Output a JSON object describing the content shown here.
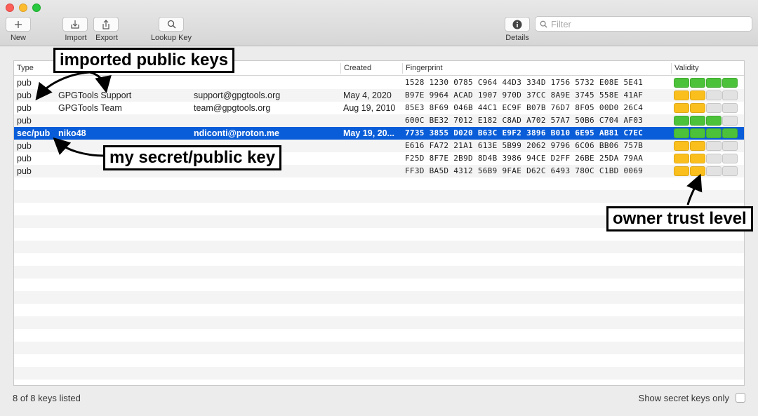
{
  "toolbar": {
    "new_label": "New",
    "import_label": "Import",
    "export_label": "Export",
    "lookup_label": "Lookup Key",
    "details_label": "Details",
    "filter_placeholder": "Filter"
  },
  "table": {
    "columns": {
      "type": "Type",
      "created": "Created",
      "fingerprint": "Fingerprint",
      "validity": "Validity"
    },
    "rows": [
      {
        "type": "pub",
        "name": "",
        "email": "",
        "created": "",
        "fingerprint": "1528 1230 0785 C964 44D3  334D 1756 5732 E08E 5E41",
        "validity": [
          "green",
          "green",
          "green",
          "green"
        ],
        "selected": false
      },
      {
        "type": "pub",
        "name": "GPGTools Support",
        "email": "support@gpgtools.org",
        "created": "May 4, 2020",
        "fingerprint": "B97E 9964 ACAD 1907 970D  37CC 8A9E 3745 558E 41AF",
        "validity": [
          "yellow",
          "yellow",
          "gray",
          "gray"
        ],
        "selected": false
      },
      {
        "type": "pub",
        "name": "GPGTools Team",
        "email": "team@gpgtools.org",
        "created": "Aug 19, 2010",
        "fingerprint": "85E3 8F69 046B 44C1 EC9F  B07B 76D7 8F05 00D0 26C4",
        "validity": [
          "yellow",
          "yellow",
          "gray",
          "gray"
        ],
        "selected": false
      },
      {
        "type": "pub",
        "name": "",
        "email": "",
        "created": "",
        "fingerprint": "600C BE32 7012 E182 C8AD  A702 57A7 50B6 C704 AF03",
        "validity": [
          "green",
          "green",
          "green",
          "gray"
        ],
        "selected": false
      },
      {
        "type": "sec/pub",
        "name": "niko48",
        "email": "ndiconti@proton.me",
        "created": "May 19, 20...",
        "fingerprint": "7735 3855 D020 B63C E9F2  3896 B010 6E95 AB81 C7EC",
        "validity": [
          "green",
          "green",
          "green",
          "green"
        ],
        "selected": true
      },
      {
        "type": "pub",
        "name": "",
        "email": "",
        "created": "",
        "fingerprint": "E616 FA72 21A1 613E 5B99  2062 9796 6C06 BB06 757B",
        "validity": [
          "yellow",
          "yellow",
          "gray",
          "gray"
        ],
        "selected": false
      },
      {
        "type": "pub",
        "name": "",
        "email": "",
        "created": "",
        "fingerprint": "F25D 8F7E 2B9D 8D4B 3986  94CE D2FF 26BE 25DA 79AA",
        "validity": [
          "yellow",
          "yellow",
          "gray",
          "gray"
        ],
        "selected": false
      },
      {
        "type": "pub",
        "name": "",
        "email": "",
        "created": "",
        "fingerprint": "FF3D BA5D 4312 56B9 9FAE  D62C 6493 780C C1BD 0069",
        "validity": [
          "yellow",
          "yellow",
          "gray",
          "gray"
        ],
        "selected": false
      }
    ]
  },
  "footer": {
    "count": "8 of 8 keys listed",
    "secret_only_label": "Show secret keys only"
  },
  "annotations": {
    "imported": "imported public keys",
    "secret": "my secret/public key",
    "trust": "owner trust level"
  },
  "colors": {
    "green": "#4cc23a",
    "yellow": "#fbbf1d",
    "gray": "#e2e2e2",
    "selection": "#0a5dd8"
  }
}
